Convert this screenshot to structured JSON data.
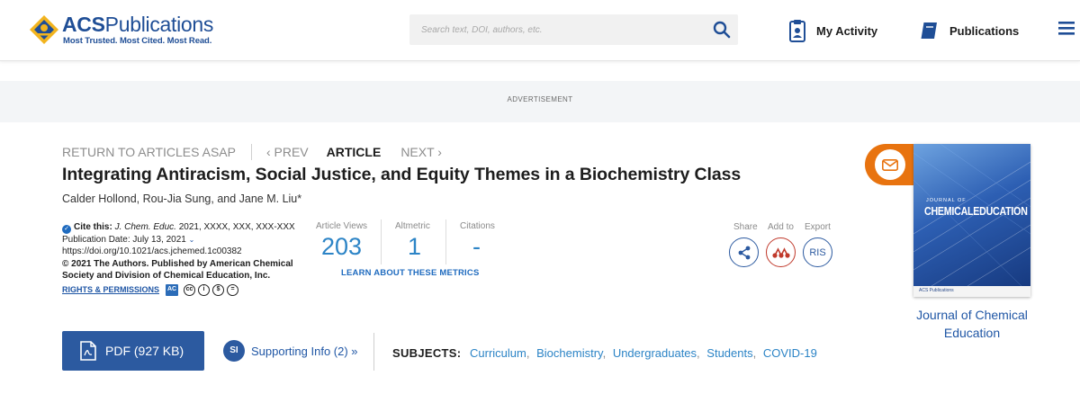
{
  "header": {
    "brand_name": "ACS",
    "brand_suffix": "Publications",
    "tagline": "Most Trusted. Most Cited. Most Read.",
    "search_placeholder": "Search text, DOI, authors, etc.",
    "my_activity_label": "My Activity",
    "publications_label": "Publications"
  },
  "advertisement_label": "ADVERTISEMENT",
  "article_nav": {
    "return_label": "RETURN TO ARTICLES ASAP",
    "prev_label": "‹ PREV",
    "current_label": "ARTICLE",
    "next_label": "NEXT ›"
  },
  "article": {
    "title": "Integrating Antiracism, Social Justice, and Equity Themes in a Biochemistry Class",
    "authors": "Calder Hollond, Rou-Jia Sung, and Jane M. Liu*"
  },
  "citation": {
    "cite_label": "Cite this:",
    "journal": "J. Chem. Educ.",
    "ref": " 2021, XXXX, XXX, XXX-XXX",
    "pub_date": "Publication Date: July 13, 2021",
    "doi": "https://doi.org/10.1021/acs.jchemed.1c00382",
    "copyright": "© 2021 The Authors. Published by American Chemical Society and Division of Chemical Education, Inc.",
    "rights_label": "RIGHTS & PERMISSIONS"
  },
  "metrics": {
    "views_label": "Article Views",
    "views_value": "203",
    "altmetric_label": "Altmetric",
    "altmetric_value": "1",
    "citations_label": "Citations",
    "citations_value": "-",
    "learn_label": "LEARN ABOUT THESE METRICS"
  },
  "actions": {
    "share_label": "Share",
    "add_label": "Add to",
    "export_label": "Export",
    "export_button": "RIS"
  },
  "cover": {
    "journal_of": "JOURNAL OF",
    "title": "CHEMICALEDUCATION",
    "publisher": "ACS Publications"
  },
  "journal_name": "Journal of Chemical Education",
  "bottom": {
    "pdf_label": "PDF (927 KB)",
    "si_badge": "SI",
    "si_label": "Supporting Info (2) »",
    "subjects_label": "SUBJECTS:",
    "subjects": [
      "Curriculum",
      "Biochemistry",
      "Undergraduates",
      "Students",
      "COVID-19"
    ]
  },
  "colors": {
    "brand_blue": "#1f4e96",
    "button_blue": "#2c5aa0",
    "metric_blue": "#2c84c6",
    "email_orange": "#e8730f",
    "add_red": "#c0392b"
  }
}
